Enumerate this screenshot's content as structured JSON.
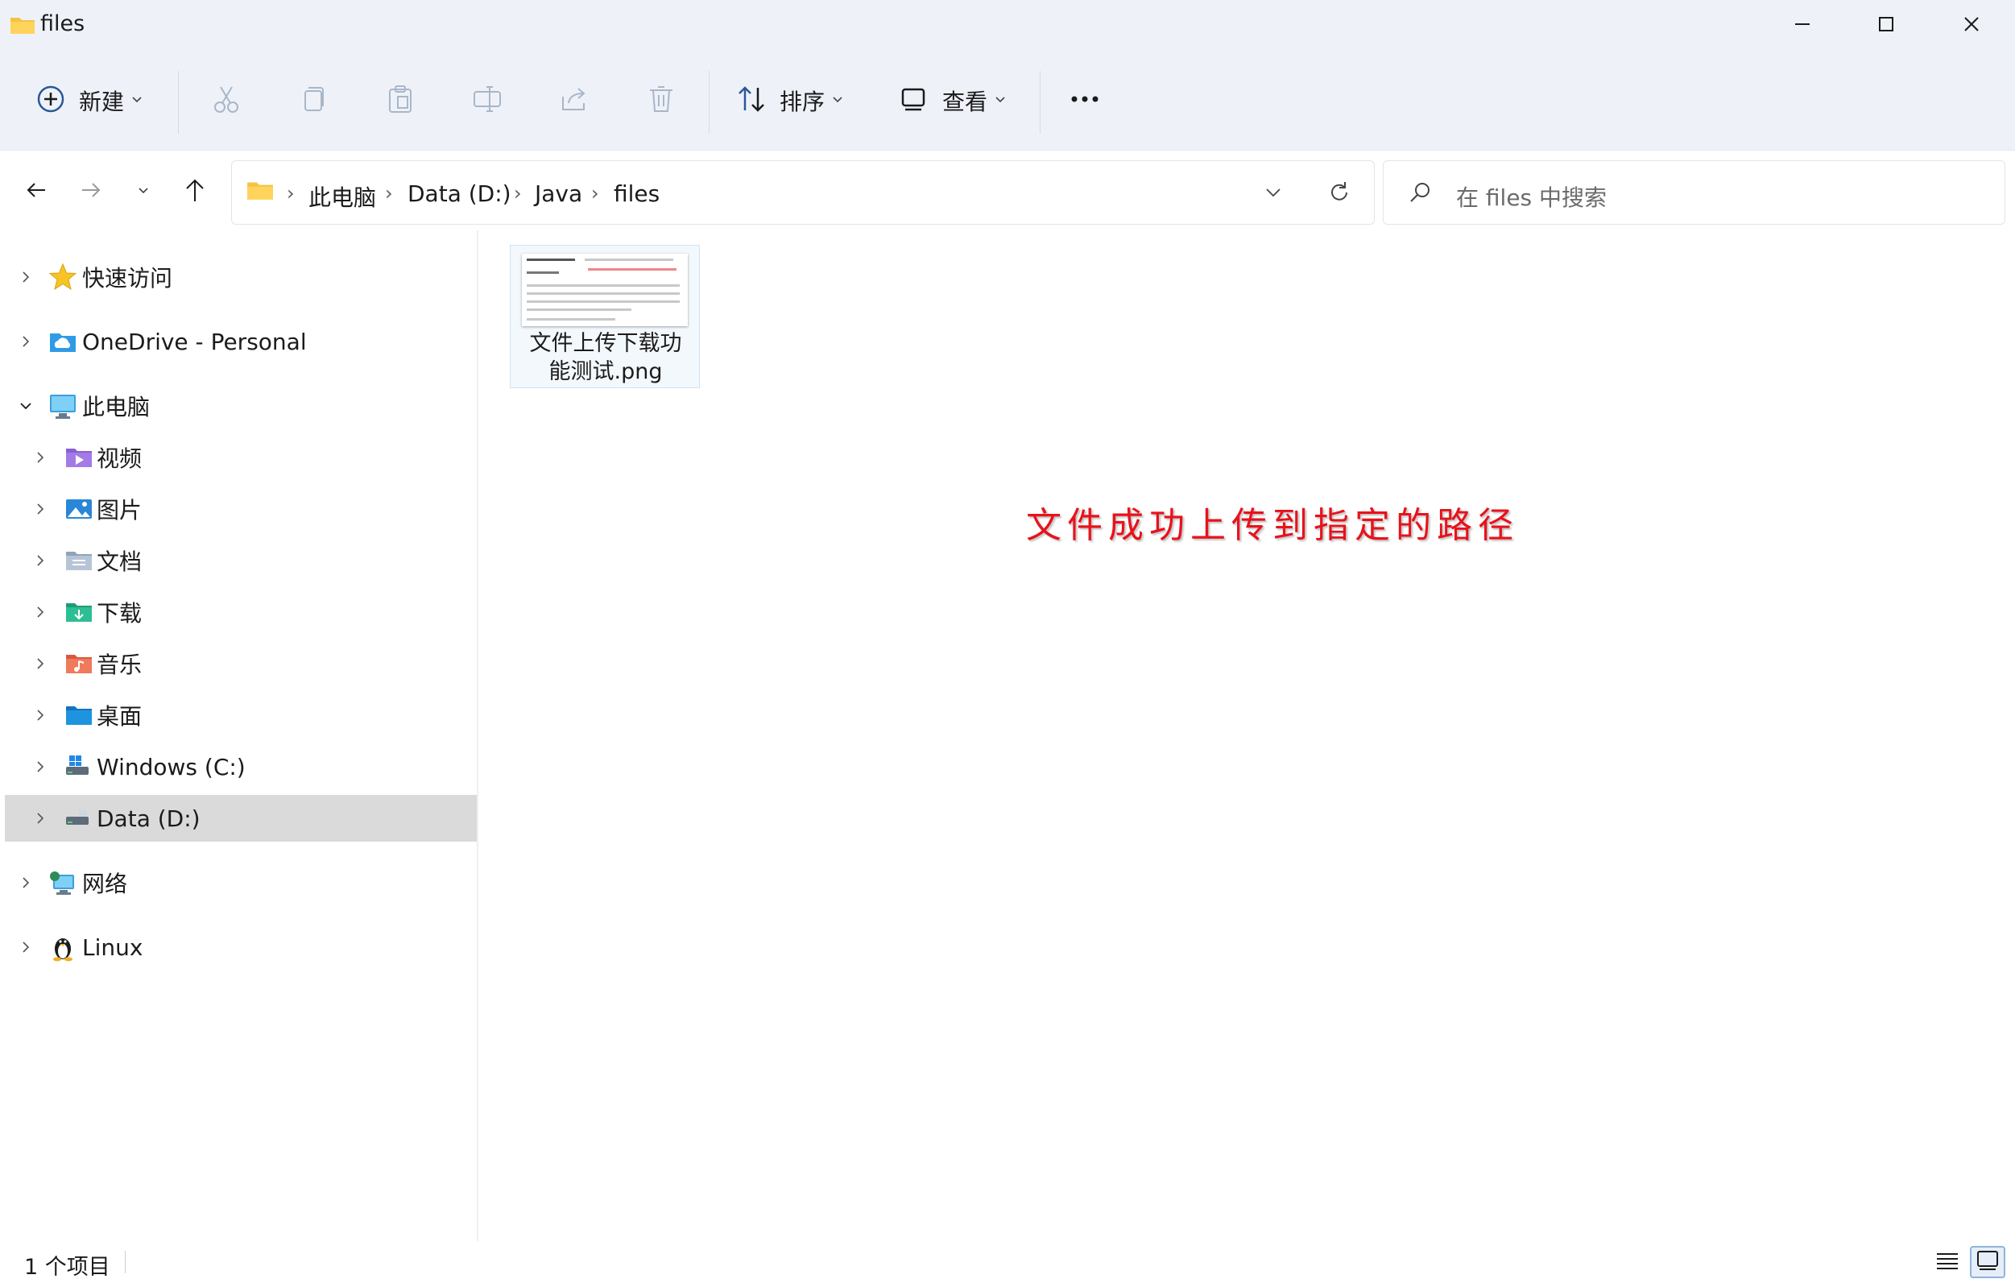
{
  "window": {
    "title": "files",
    "minimize_icon": "minimize-icon",
    "maximize_icon": "maximize-icon",
    "close_icon": "close-icon"
  },
  "toolbar": {
    "new_label": "新建",
    "sort_label": "排序",
    "view_label": "查看",
    "actions": [
      "cut-icon",
      "copy-icon",
      "paste-icon",
      "rename-icon",
      "share-icon",
      "delete-icon",
      "more-icon"
    ]
  },
  "address": {
    "breadcrumbs": [
      "此电脑",
      "Data (D:)",
      "Java",
      "files"
    ],
    "separator": "›"
  },
  "search": {
    "placeholder": "在 files 中搜索"
  },
  "sidebar": {
    "items": [
      {
        "label": "快速访问",
        "icon": "star-icon"
      },
      {
        "label": "OneDrive - Personal",
        "icon": "cloud-folder-icon"
      },
      {
        "label": "此电脑",
        "icon": "monitor-icon"
      },
      {
        "label": "视频",
        "icon": "video-folder-icon"
      },
      {
        "label": "图片",
        "icon": "pictures-folder-icon"
      },
      {
        "label": "文档",
        "icon": "documents-folder-icon"
      },
      {
        "label": "下载",
        "icon": "downloads-folder-icon"
      },
      {
        "label": "音乐",
        "icon": "music-folder-icon"
      },
      {
        "label": "桌面",
        "icon": "desktop-folder-icon"
      },
      {
        "label": "Windows (C:)",
        "icon": "windows-drive-icon"
      },
      {
        "label": "Data (D:)",
        "icon": "drive-icon"
      },
      {
        "label": "网络",
        "icon": "network-icon"
      },
      {
        "label": "Linux",
        "icon": "linux-penguin-icon"
      }
    ]
  },
  "files": [
    {
      "name_line1": "文件上传下载功",
      "name_line2": "能测试.png"
    }
  ],
  "annotation": "文件成功上传到指定的路径",
  "status": {
    "count": "1 个项目"
  },
  "colors": {
    "chrome": "#eef2f8",
    "selected": "#dadada",
    "annotation": "#e8121b",
    "folder": "#f5c342"
  }
}
